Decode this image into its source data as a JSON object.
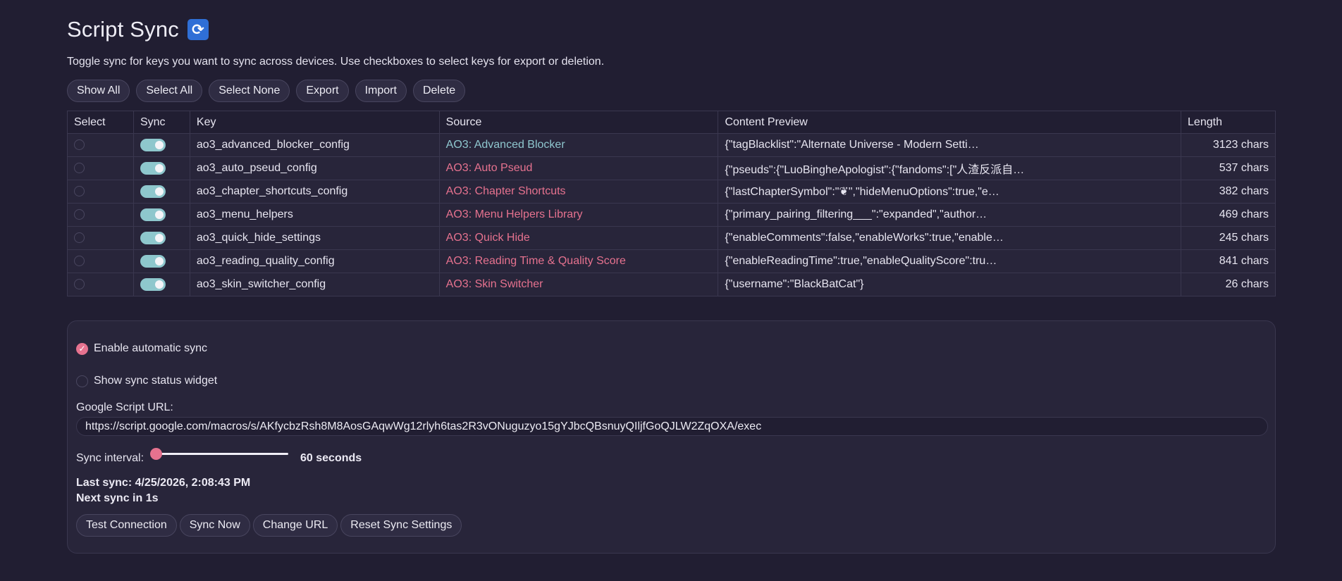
{
  "header": {
    "title": "Script Sync",
    "icon": "sync-icon",
    "description": "Toggle sync for keys you want to sync across devices. Use checkboxes to select keys for export or deletion."
  },
  "toolbar": {
    "show_all": "Show All",
    "select_all": "Select All",
    "select_none": "Select None",
    "export": "Export",
    "import": "Import",
    "delete": "Delete"
  },
  "table": {
    "columns": [
      "Select",
      "Sync",
      "Key",
      "Source",
      "Content Preview",
      "Length"
    ],
    "rows": [
      {
        "key": "ao3_advanced_blocker_config",
        "source": "AO3: Advanced Blocker",
        "preview": "{\"tagBlacklist\":\"Alternate Universe - Modern Setti…",
        "length": "3123 chars",
        "synced": true
      },
      {
        "key": "ao3_auto_pseud_config",
        "source": "AO3: Auto Pseud",
        "preview": "{\"pseuds\":{\"LuoBingheApologist\":{\"fandoms\":[\"人渣反派自…",
        "length": "537 chars",
        "synced": true
      },
      {
        "key": "ao3_chapter_shortcuts_config",
        "source": "AO3: Chapter Shortcuts",
        "preview": "{\"lastChapterSymbol\":\"❦\",\"hideMenuOptions\":true,\"e…",
        "length": "382 chars",
        "synced": true
      },
      {
        "key": "ao3_menu_helpers",
        "source": "AO3: Menu Helpers Library",
        "preview": "{\"primary_pairing_filtering___\":\"expanded\",\"author…",
        "length": "469 chars",
        "synced": true
      },
      {
        "key": "ao3_quick_hide_settings",
        "source": "AO3: Quick Hide",
        "preview": "{\"enableComments\":false,\"enableWorks\":true,\"enable…",
        "length": "245 chars",
        "synced": true
      },
      {
        "key": "ao3_reading_quality_config",
        "source": "AO3: Reading Time & Quality Score",
        "preview": "{\"enableReadingTime\":true,\"enableQualityScore\":tru…",
        "length": "841 chars",
        "synced": true
      },
      {
        "key": "ao3_skin_switcher_config",
        "source": "AO3: Skin Switcher",
        "preview": "{\"username\":\"BlackBatCat\"}",
        "length": "26 chars",
        "synced": true
      }
    ]
  },
  "settings": {
    "auto_sync_label": "Enable automatic sync",
    "auto_sync_checked": true,
    "widget_label": "Show sync status widget",
    "widget_checked": false,
    "url_label": "Google Script URL:",
    "url_value": "https://script.google.com/macros/s/AKfycbzRsh8M8AosGAqwWg12rlyh6tas2R3vONuguzyo15gYJbcQBsnuyQIljfGoQJLW2ZqOXA/exec",
    "interval_label": "Sync interval:",
    "interval_value": "60 seconds",
    "interval_fraction": 0,
    "last_sync": "Last sync: 4/25/2026, 2:08:43 PM",
    "next_sync": "Next sync in 1s",
    "buttons": {
      "test": "Test Connection",
      "sync_now": "Sync Now",
      "change_url": "Change URL",
      "reset": "Reset Sync Settings"
    }
  },
  "colors": {
    "background": "#211e32",
    "accent": "#e6728f",
    "toggle_on": "#8ec7cd"
  }
}
